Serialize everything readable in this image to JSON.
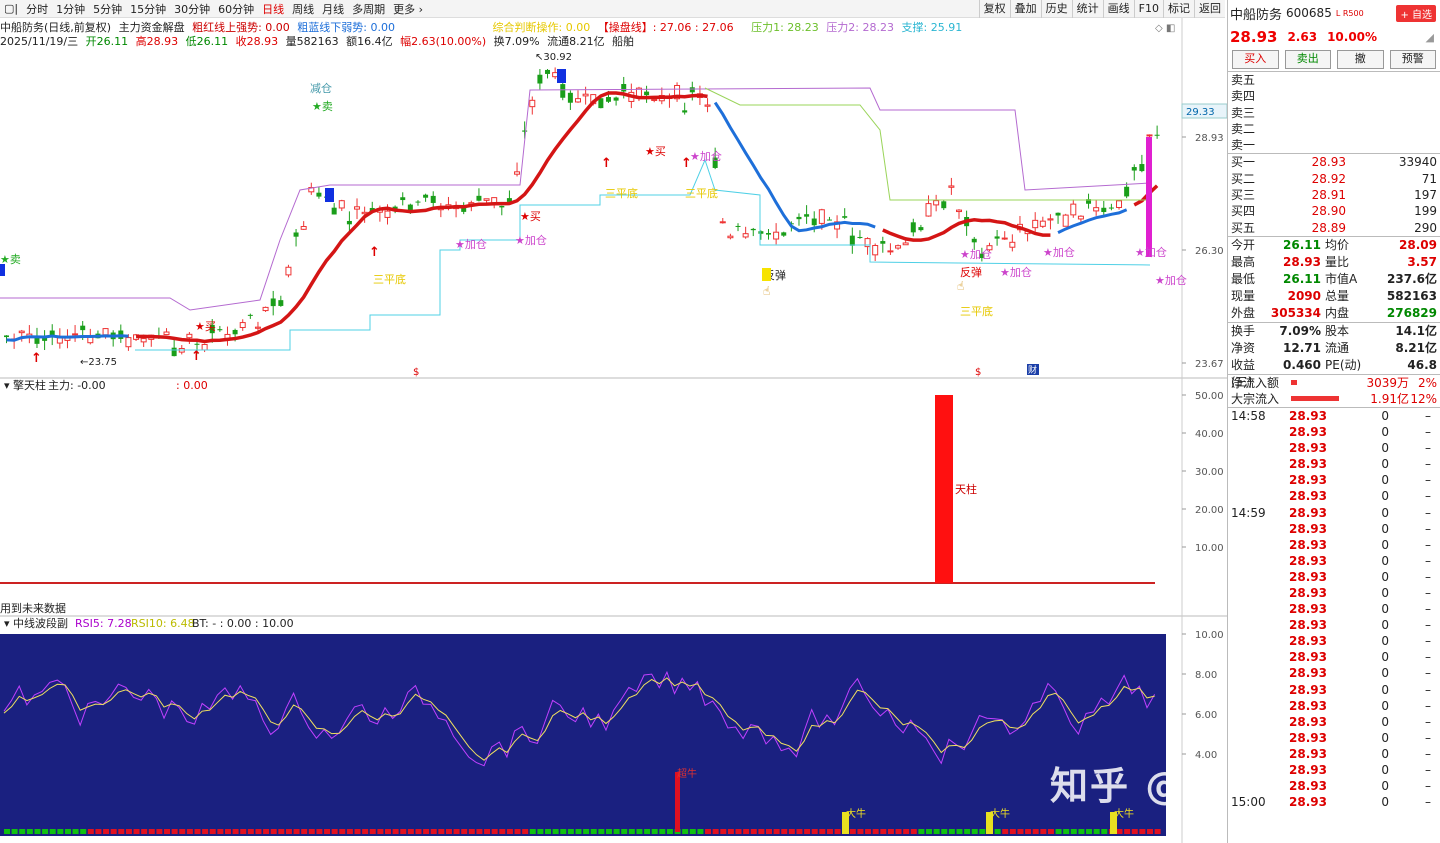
{
  "toolbar": {
    "items": [
      "分时",
      "1分钟",
      "5分钟",
      "15分钟",
      "30分钟",
      "60分钟",
      "日线",
      "周线",
      "月线",
      "多周期",
      "更多"
    ],
    "active": "日线",
    "right": [
      "复权",
      "叠加",
      "历史",
      "统计",
      "画线",
      "F10",
      "标记",
      "返回"
    ]
  },
  "info": {
    "title": "中船防务(日线,前复权)",
    "ind1": "主力资金解盘",
    "ind2": "粗红线上强势: 0.00",
    "ind3": "粗蓝线下弱势: 0.00",
    "ind4": "综合判断操作: 0.00",
    "ind5": "【操盘线】: 27.06 : 27.06",
    "ind6": "压力1: 28.23",
    "ind7": "压力2: 28.23",
    "ind8": "支撑: 25.91",
    "date": "2025/11/19/三",
    "open": "开26.11",
    "high": "高28.93",
    "low": "低26.11",
    "close": "收28.93",
    "vol": "量582163",
    "amt": "额16.4亿",
    "chg": "幅2.63(10.00%)",
    "turn": "换7.09%",
    "flow": "流通8.21亿",
    "sector": "船舶"
  },
  "sub1": {
    "title": "擎天柱",
    "main": "主力: -0.00",
    "val": ": 0.00",
    "note": "用到未来数据",
    "bar_label": "天柱",
    "ticks": [
      "50.00",
      "40.00",
      "30.00",
      "20.00",
      "10.00"
    ]
  },
  "sub2": {
    "title": "中线波段副",
    "rsi5": "RSI5: 7.28",
    "rsi10": "RSI10: 6.48",
    "bt": "BT: -  : 0.00 : 10.00",
    "ticks": [
      "10.00",
      "8.00",
      "6.00",
      "4.00"
    ],
    "labels": [
      "超牛",
      "大牛",
      "大牛",
      "大牛"
    ]
  },
  "main_chart": {
    "price_ticks": [
      "28.93",
      "26.30",
      "23.67"
    ],
    "current_tag": "29.33",
    "high_label": "30.92",
    "low_label": "23.75",
    "annotations": [
      "减仓",
      "卖",
      "卖",
      "买",
      "买",
      "买",
      "三平底",
      "三平底",
      "三平底",
      "三平底",
      "加仓",
      "加仓",
      "加仓",
      "加仓",
      "加仓",
      "加仓",
      "加仓",
      "加仓",
      "反弹",
      "反弹"
    ],
    "bottom_marks": [
      "$",
      "$",
      "财"
    ]
  },
  "quote": {
    "name": "中船防务",
    "code": "600685",
    "l_tag": "L R500",
    "add_btn": "+ 自选",
    "price": "28.93",
    "chg": "2.63",
    "pct": "10.00%",
    "bell": "◢",
    "buttons": [
      "买入",
      "卖出",
      "撤",
      "预警"
    ],
    "asks": [
      {
        "label": "卖五",
        "p": "",
        "v": ""
      },
      {
        "label": "卖四",
        "p": "",
        "v": ""
      },
      {
        "label": "卖三",
        "p": "",
        "v": ""
      },
      {
        "label": "卖二",
        "p": "",
        "v": ""
      },
      {
        "label": "卖一",
        "p": "",
        "v": ""
      }
    ],
    "bids": [
      {
        "label": "买一",
        "p": "28.93",
        "v": "33940"
      },
      {
        "label": "买二",
        "p": "28.92",
        "v": "71"
      },
      {
        "label": "买三",
        "p": "28.91",
        "v": "197"
      },
      {
        "label": "买四",
        "p": "28.90",
        "v": "199"
      },
      {
        "label": "买五",
        "p": "28.89",
        "v": "290"
      }
    ],
    "stats": [
      {
        "k": "今开",
        "v": "26.11",
        "vc": "green",
        "k2": "均价",
        "v2": "28.09",
        "v2c": "red"
      },
      {
        "k": "最高",
        "v": "28.93",
        "vc": "red",
        "k2": "量比",
        "v2": "3.57",
        "v2c": "red"
      },
      {
        "k": "最低",
        "v": "26.11",
        "vc": "green",
        "k2": "市值A",
        "v2": "237.6亿",
        "v2c": "blk"
      },
      {
        "k": "现量",
        "v": "2090",
        "vc": "red",
        "k2": "总量",
        "v2": "582163",
        "v2c": "blk"
      },
      {
        "k": "外盘",
        "v": "305334",
        "vc": "red",
        "k2": "内盘",
        "v2": "276829",
        "v2c": "green"
      }
    ],
    "stats2": [
      {
        "k": "换手",
        "v": "7.09%",
        "k2": "股本",
        "v2": "14.1亿"
      },
      {
        "k": "净资",
        "v": "12.71",
        "k2": "流通",
        "v2": "8.21亿"
      },
      {
        "k": "收益(三)",
        "v": "0.460",
        "k2": "PE(动)",
        "v2": "46.8"
      }
    ],
    "flows": [
      {
        "k": "净流入额",
        "v": "3039万",
        "pc": "2%",
        "w": 6
      },
      {
        "k": "大宗流入",
        "v": "1.91亿",
        "pc": "12%",
        "w": 48
      }
    ],
    "ticks": [
      {
        "t": "14:58",
        "p": "28.93",
        "q": "0",
        "f": "–"
      },
      {
        "t": "",
        "p": "28.93",
        "q": "0",
        "f": "–"
      },
      {
        "t": "",
        "p": "28.93",
        "q": "0",
        "f": "–"
      },
      {
        "t": "",
        "p": "28.93",
        "q": "0",
        "f": "–"
      },
      {
        "t": "",
        "p": "28.93",
        "q": "0",
        "f": "–"
      },
      {
        "t": "",
        "p": "28.93",
        "q": "0",
        "f": "–"
      },
      {
        "t": "14:59",
        "p": "28.93",
        "q": "0",
        "f": "–"
      },
      {
        "t": "",
        "p": "28.93",
        "q": "0",
        "f": "–"
      },
      {
        "t": "",
        "p": "28.93",
        "q": "0",
        "f": "–"
      },
      {
        "t": "",
        "p": "28.93",
        "q": "0",
        "f": "–"
      },
      {
        "t": "",
        "p": "28.93",
        "q": "0",
        "f": "–"
      },
      {
        "t": "",
        "p": "28.93",
        "q": "0",
        "f": "–"
      },
      {
        "t": "",
        "p": "28.93",
        "q": "0",
        "f": "–"
      },
      {
        "t": "",
        "p": "28.93",
        "q": "0",
        "f": "–"
      },
      {
        "t": "",
        "p": "28.93",
        "q": "0",
        "f": "–"
      },
      {
        "t": "",
        "p": "28.93",
        "q": "0",
        "f": "–"
      },
      {
        "t": "",
        "p": "28.93",
        "q": "0",
        "f": "–"
      },
      {
        "t": "",
        "p": "28.93",
        "q": "0",
        "f": "–"
      },
      {
        "t": "",
        "p": "28.93",
        "q": "0",
        "f": "–"
      },
      {
        "t": "",
        "p": "28.93",
        "q": "0",
        "f": "–"
      },
      {
        "t": "",
        "p": "28.93",
        "q": "0",
        "f": "–"
      },
      {
        "t": "",
        "p": "28.93",
        "q": "0",
        "f": "–"
      },
      {
        "t": "",
        "p": "28.93",
        "q": "0",
        "f": "–"
      },
      {
        "t": "",
        "p": "28.93",
        "q": "0",
        "f": "–"
      },
      {
        "t": "15:00",
        "p": "28.93",
        "q": "0",
        "f": "–"
      }
    ]
  },
  "watermark": "知乎 @股海自为家",
  "colors": {
    "up": "#e33",
    "down": "#1a9e1a",
    "blueline": "#1e6fd9",
    "redline": "#d41515",
    "purple": "#b46ad0",
    "cyan": "#4fd0e6",
    "lightgreen": "#9ad45a",
    "navy": "#1a2080"
  }
}
